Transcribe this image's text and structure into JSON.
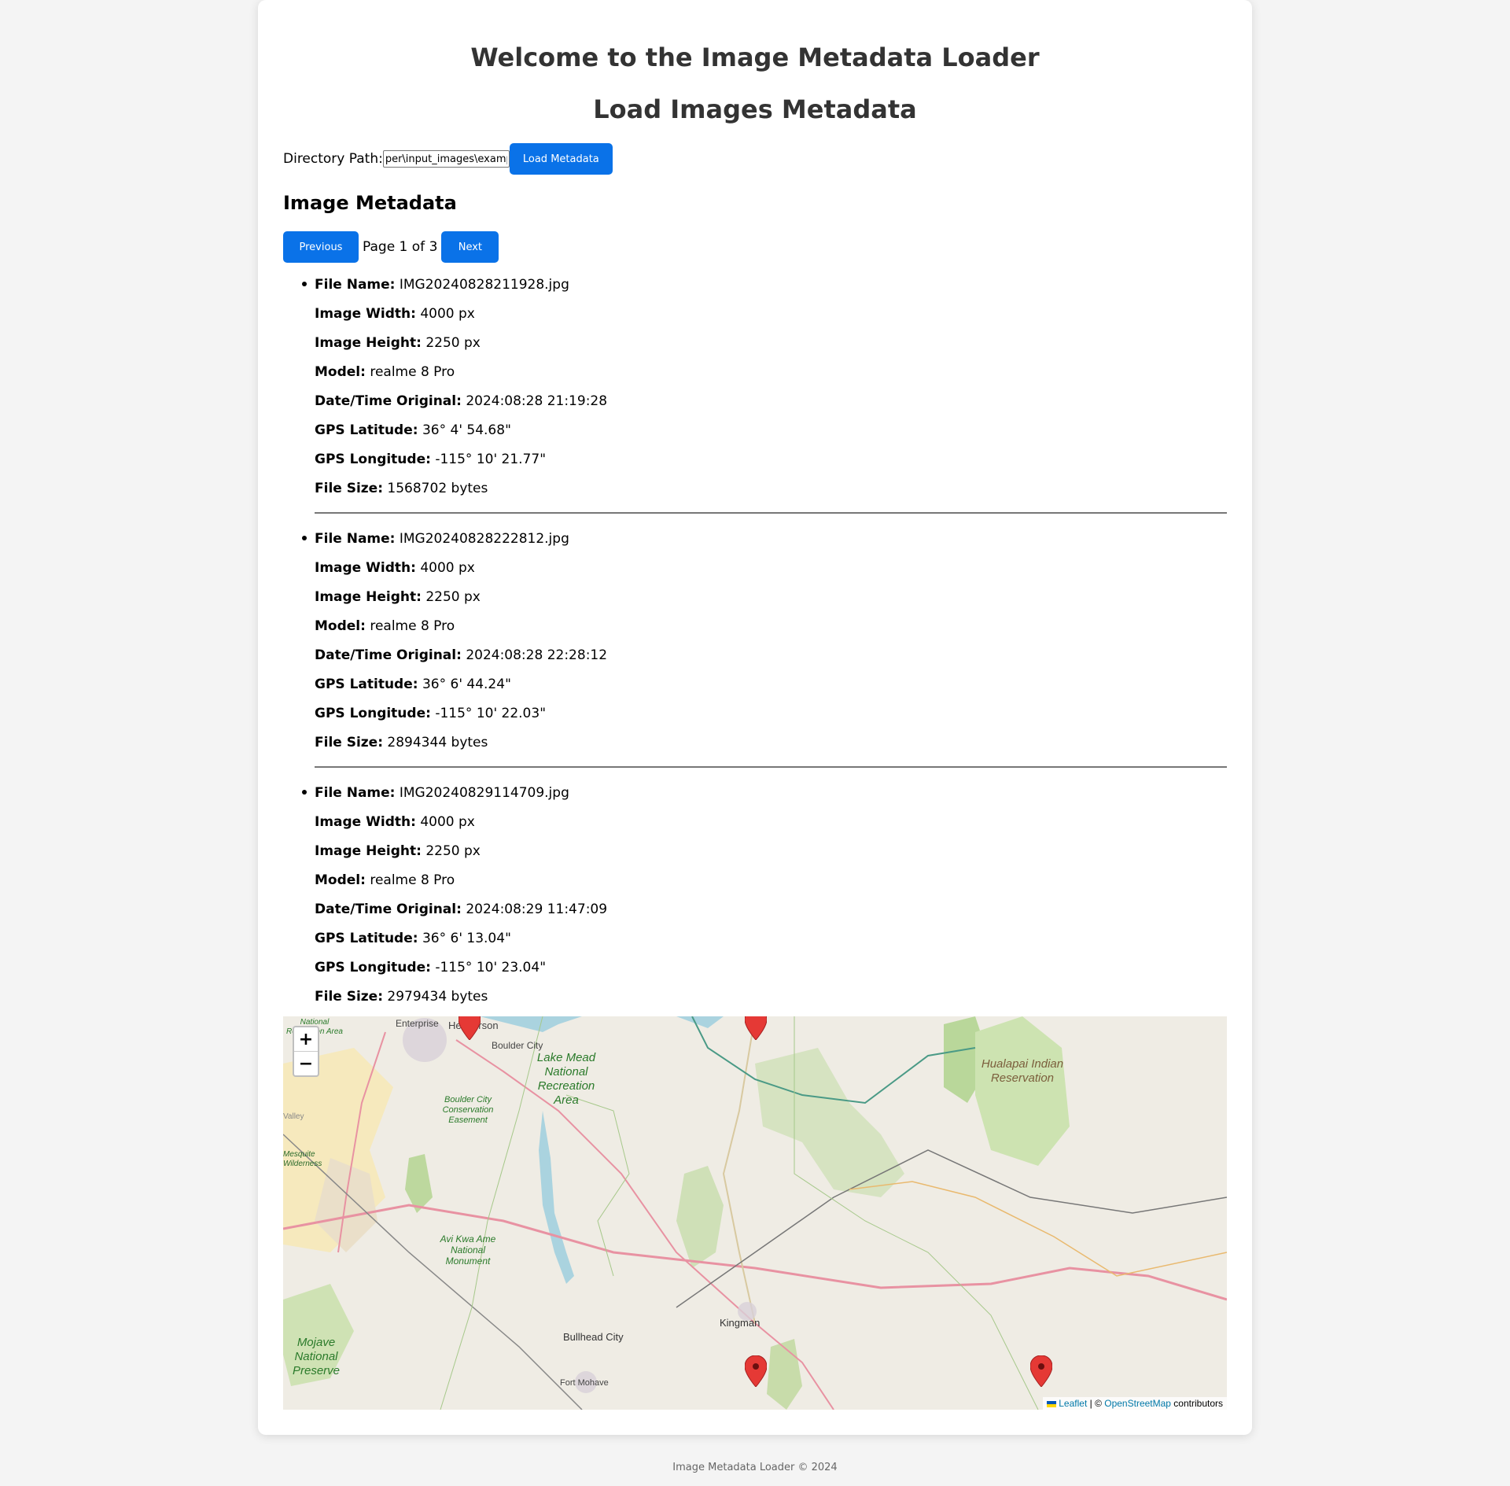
{
  "header": {
    "title": "Welcome to the Image Metadata Loader",
    "subtitle": "Load Images Metadata"
  },
  "loader": {
    "dir_label": "Directory Path:",
    "dir_value": "per\\input_images\\example",
    "load_button": "Load Metadata"
  },
  "metadata": {
    "heading": "Image Metadata",
    "prev_label": "Previous",
    "page_text": "Page 1 of 3",
    "next_label": "Next",
    "labels": {
      "file_name": "File Name:",
      "width": "Image Width:",
      "height": "Image Height:",
      "model": "Model:",
      "datetime": "Date/Time Original:",
      "lat": "GPS Latitude:",
      "lon": "GPS Longitude:",
      "size": "File Size:"
    },
    "items": [
      {
        "file_name": "IMG20240828211928.jpg",
        "width": "4000 px",
        "height": "2250 px",
        "model": "realme 8 Pro",
        "datetime": "2024:08:28 21:19:28",
        "lat": "36° 4' 54.68\"",
        "lon": "-115° 10' 21.77\"",
        "size": "1568702 bytes"
      },
      {
        "file_name": "IMG20240828222812.jpg",
        "width": "4000 px",
        "height": "2250 px",
        "model": "realme 8 Pro",
        "datetime": "2024:08:28 22:28:12",
        "lat": "36° 6' 44.24\"",
        "lon": "-115° 10' 22.03\"",
        "size": "2894344 bytes"
      },
      {
        "file_name": "IMG20240829114709.jpg",
        "width": "4000 px",
        "height": "2250 px",
        "model": "realme 8 Pro",
        "datetime": "2024:08:29 11:47:09",
        "lat": "36° 6' 13.04\"",
        "lon": "-115° 10' 23.04\"",
        "size": "2979434 bytes"
      }
    ]
  },
  "map": {
    "zoom_in": "+",
    "zoom_out": "−",
    "attribution_leaflet": "Leaflet",
    "attribution_sep": " | © ",
    "attribution_osm": "OpenStreetMap",
    "attribution_tail": " contributors",
    "places": {
      "enterprise": "Enterprise",
      "henderson": "Henderson",
      "boulder_city": "Boulder City",
      "lake_mead": "Lake Mead National Recreation Area",
      "boulder_easement": "Boulder City Conservation Easement",
      "hualapai": "Hualapai Indian Reservation",
      "avi_kwa": "Avi Kwa Ame National Monument",
      "mojave": "Mojave National Preserve",
      "bullhead": "Bullhead City",
      "kingman": "Kingman",
      "fort_mohave": "Fort Mohave",
      "national_rec": "National Recreation Area",
      "mesquite": "Mesquite Wilderness",
      "valley": "Valley"
    },
    "marker_color": "#e53935"
  },
  "footer": {
    "text": "Image Metadata Loader © 2024"
  }
}
